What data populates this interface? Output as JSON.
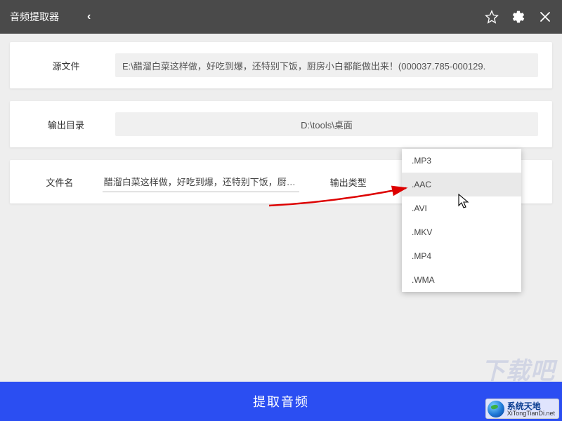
{
  "titlebar": {
    "app_title": "音频提取器",
    "back_glyph": "‹"
  },
  "rows": {
    "source_label": "源文件",
    "source_value": "E:\\醋溜白菜这样做，好吃到爆，还特别下饭，厨房小白都能做出来！(000037.785-000129.",
    "output_dir_label": "输出目录",
    "output_dir_value": "D:\\tools\\桌面",
    "filename_label": "文件名",
    "filename_value": "醋溜白菜这样做，好吃到爆，还特别下饭，厨房小白",
    "type_label": "输出类型"
  },
  "dropdown": {
    "options": [
      ".MP3",
      ".AAC",
      ".AVI",
      ".MKV",
      ".MP4",
      ".WMA"
    ],
    "hover_index": 1
  },
  "buttons": {
    "extract": "提取音频"
  },
  "watermark": {
    "title": "系统天地",
    "url": "XiTongTianDi.net"
  }
}
